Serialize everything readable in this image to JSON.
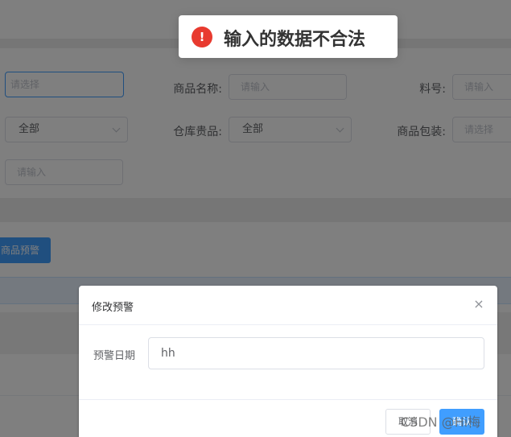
{
  "toast": {
    "icon": "error-icon",
    "icon_glyph": "!",
    "message": "输入的数据不合法"
  },
  "filters": {
    "row1": {
      "select_placeholder": "请选择",
      "name_label": "商品名称:",
      "name_placeholder": "请输入",
      "sku_label": "料号:",
      "sku_placeholder": "请输入"
    },
    "row2": {
      "first_value": "全部",
      "warehouse_label": "仓库贵品:",
      "warehouse_value": "全部",
      "packaging_label": "商品包装:",
      "packaging_placeholder": "请选择"
    },
    "row3": {
      "input_placeholder": "请输入"
    }
  },
  "actions": {
    "warning_button": "商品预警"
  },
  "dialog": {
    "title": "修改预警",
    "close_glyph": "×",
    "field_label": "预警日期",
    "field_value": "hh",
    "cancel_label": "取消",
    "confirm_label": "确认"
  },
  "watermark": "CSDN @Hi梅",
  "colors": {
    "primary": "#409eff",
    "error": "#e83a2f",
    "mask": "rgba(0,0,0,0.5)"
  }
}
